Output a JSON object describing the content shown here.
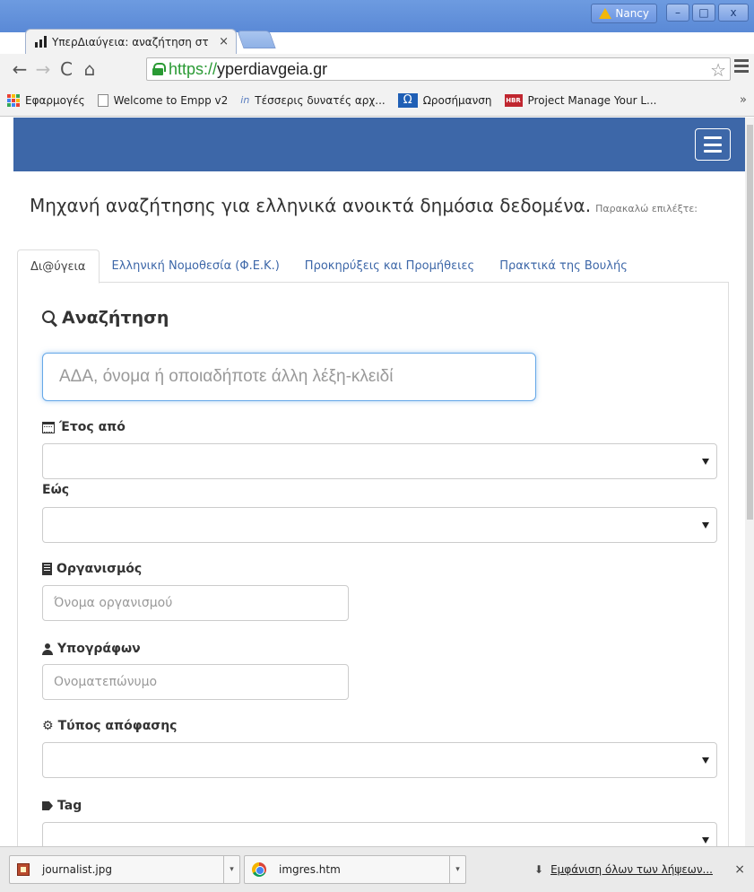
{
  "browser": {
    "tab_title": "ΥπερΔιαύγεια: αναζήτηση στ",
    "tab_close": "×",
    "user_name": "Nancy",
    "url_scheme": "https://",
    "url_host": "yperdiavgeia.gr",
    "window_min": "–",
    "window_max": "□",
    "window_close": "x",
    "more_bookmarks": "»"
  },
  "bookmarks": [
    {
      "label": "Εφαρμογές",
      "icon": "apps-grid-icon"
    },
    {
      "label": "Welcome to Empp v2",
      "icon": "page-icon"
    },
    {
      "label": "Τέσσερις δυνατές αρχ...",
      "icon": "in-icon"
    },
    {
      "label": "Ωροσήμανση",
      "icon": "omega-icon"
    },
    {
      "label": "Project Manage Your L...",
      "icon": "hbr-icon",
      "icon_text": "HBR"
    }
  ],
  "page": {
    "lead_big": "Μηχανή αναζήτησης για ελληνικά ανοικτά δημόσια δεδομένα.",
    "lead_small": "Παρακαλώ επιλέξτε:",
    "tabs": [
      {
        "label": "Δι@ύγεια",
        "active": true
      },
      {
        "label": "Ελληνική Νομοθεσία (Φ.Ε.Κ.)",
        "active": false
      },
      {
        "label": "Προκηρύξεις και Προμήθειες",
        "active": false
      },
      {
        "label": "Πρακτικά της Βουλής",
        "active": false
      }
    ],
    "search_heading": "Αναζήτηση",
    "search_placeholder": "ΑΔΑ, όνομα ή οποιαδήποτε άλλη λέξη-κλειδί",
    "year_from_label": "Έτος από",
    "year_to_label": "Εώς",
    "org_label": "Οργανισμός",
    "org_placeholder": "Όνομα οργανισμού",
    "signer_label": "Υπογράφων",
    "signer_placeholder": "Ονοματεπώνυμο",
    "decision_type_label": "Τύπος απόφασης",
    "tag_label": "Tag"
  },
  "downloads": {
    "items": [
      {
        "filename": "journalist.jpg",
        "icon": "image-file-icon"
      },
      {
        "filename": "imgres.htm",
        "icon": "chrome-icon"
      }
    ],
    "show_all": "Εμφάνιση όλων των λήψεων...",
    "close": "×"
  },
  "colors": {
    "navbar": "#3d67a8",
    "link": "#3d67a8",
    "secure": "#2a9a34",
    "focus": "#66a8e8"
  }
}
